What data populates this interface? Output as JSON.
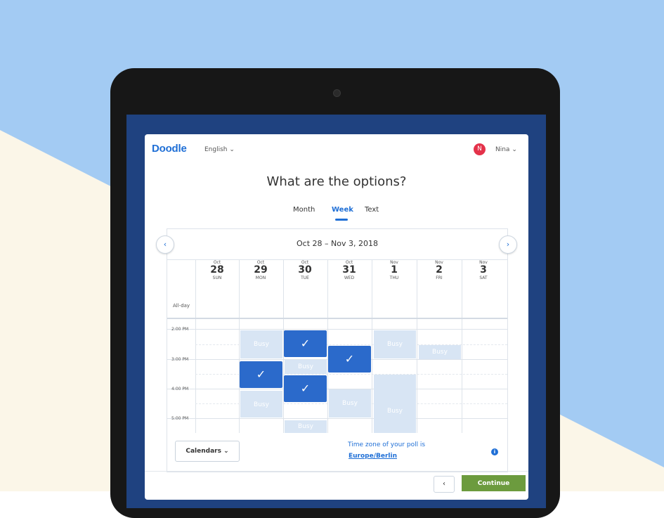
{
  "app": {
    "logo": "Doodle",
    "language": "English ⌄",
    "user_initial": "N",
    "user_name": "Nina ⌄"
  },
  "page": {
    "title": "What are the options?"
  },
  "tabs": [
    {
      "label": "Month"
    },
    {
      "label": "Week",
      "active": true
    },
    {
      "label": "Text"
    }
  ],
  "calendar": {
    "range": "Oct 28 – Nov 3, 2018",
    "prev_icon": "‹",
    "next_icon": "›",
    "days": [
      {
        "month": "Oct",
        "date": "28",
        "weekday": "SUN"
      },
      {
        "month": "Oct",
        "date": "29",
        "weekday": "MON"
      },
      {
        "month": "Oct",
        "date": "30",
        "weekday": "TUE"
      },
      {
        "month": "Oct",
        "date": "31",
        "weekday": "WED"
      },
      {
        "month": "Nov",
        "date": "1",
        "weekday": "THU"
      },
      {
        "month": "Nov",
        "date": "2",
        "weekday": "FRI"
      },
      {
        "month": "Nov",
        "date": "3",
        "weekday": "SAT"
      }
    ],
    "allday_label": "All-day",
    "times": [
      "2:00 PM",
      "3:00 PM",
      "4:00 PM",
      "5:00 PM"
    ],
    "busy_label": "Busy",
    "check_icon": "✓"
  },
  "footer": {
    "calendars_button": "Calendars ⌄",
    "timezone_text": "Time zone of your poll is",
    "timezone_link": "Europe/Berlin",
    "info_icon": "i",
    "back_button": "‹",
    "continue_button": "Continue"
  },
  "colors": {
    "primary": "#1f6fd6",
    "slot": "#2b6acb",
    "busy": "#d8e5f4",
    "continue": "#6c9b3e",
    "avatar": "#e4324a"
  }
}
